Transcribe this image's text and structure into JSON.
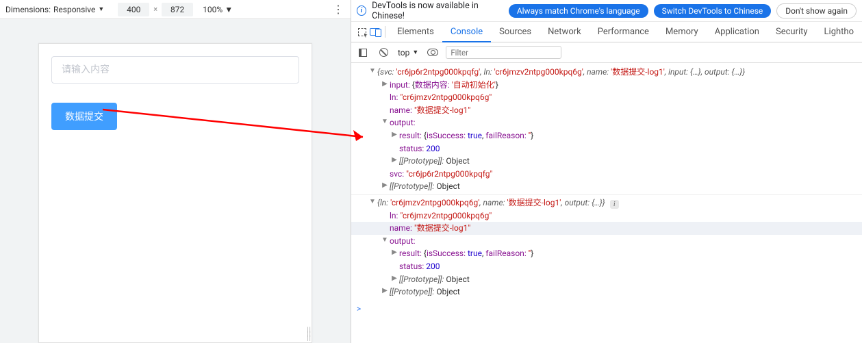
{
  "device_toolbar": {
    "dimensions_label": "Dimensions:",
    "mode": "Responsive",
    "width": "400",
    "height": "872",
    "zoom": "100%"
  },
  "preview": {
    "input_placeholder": "请输入内容",
    "button_label": "数据提交"
  },
  "banner": {
    "msg": "DevTools is now available in Chinese!",
    "btn_match": "Always match Chrome's language",
    "btn_switch": "Switch DevTools to Chinese",
    "btn_dismiss": "Don't show again"
  },
  "tabs": {
    "elements": "Elements",
    "console": "Console",
    "sources": "Sources",
    "network": "Network",
    "performance": "Performance",
    "memory": "Memory",
    "application": "Application",
    "security": "Security",
    "lighthouse": "Lightho"
  },
  "console_toolbar": {
    "context": "top",
    "filter_placeholder": "Filter"
  },
  "log1": {
    "summary_svc_key": "svc:",
    "summary_svc_val": "'cr6jp6r2ntpg000kpqfg'",
    "summary_ln_key": "ln:",
    "summary_ln_val": "'cr6jmzv2ntpg000kpq6g'",
    "summary_name_key": "name:",
    "summary_name_val": "'数据提交-log1'",
    "summary_input_key": "input:",
    "summary_input_val": "{…}",
    "summary_output_key": "output:",
    "summary_output_val": "{…}",
    "input_label": "input:",
    "input_k1": "数据内容:",
    "input_v1": "'自动初始化'",
    "ln_key": "ln:",
    "ln_val": "\"cr6jmzv2ntpg000kpq6g\"",
    "name_key": "name:",
    "name_val": "\"数据提交-log1\"",
    "output_label": "output:",
    "result_key": "result:",
    "result_obj_open": "{",
    "result_k1": "isSuccess:",
    "result_v1": "true",
    "result_k2": "failReason:",
    "result_v2": "''",
    "result_obj_close": "}",
    "status_key": "status:",
    "status_val": "200",
    "proto_key": "[[Prototype]]:",
    "proto_val": "Object",
    "svc_key": "svc:",
    "svc_val": "\"cr6jp6r2ntpg000kpqfg\""
  },
  "log2": {
    "summary_ln_key": "ln:",
    "summary_ln_val": "'cr6jmzv2ntpg000kpq6g'",
    "summary_name_key": "name:",
    "summary_name_val": "'数据提交-log1'",
    "summary_output_key": "output:",
    "summary_output_val": "{…}",
    "ln_key": "ln:",
    "ln_val": "\"cr6jmzv2ntpg000kpq6g\"",
    "name_key": "name:",
    "name_val": "\"数据提交-log1\"",
    "output_label": "output:",
    "result_key": "result:",
    "result_obj_open": "{",
    "result_k1": "isSuccess:",
    "result_v1": "true",
    "result_k2": "failReason:",
    "result_v2": "''",
    "result_obj_close": "}",
    "status_key": "status:",
    "status_val": "200",
    "proto_key": "[[Prototype]]:",
    "proto_val": "Object"
  }
}
